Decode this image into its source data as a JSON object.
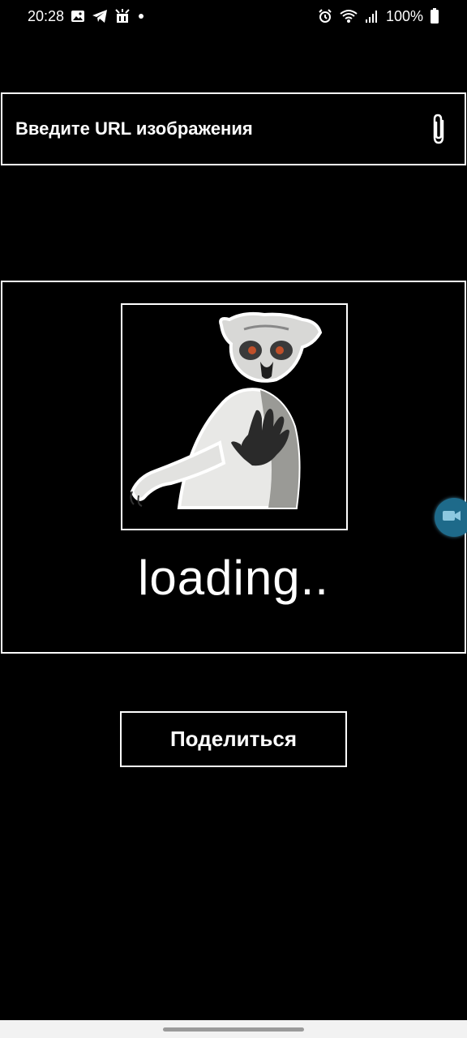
{
  "status_bar": {
    "time": "20:28",
    "battery": "100%",
    "left_icons": [
      "gallery-icon",
      "telegram-icon",
      "notification-icon",
      "dot-icon"
    ],
    "right_icons": [
      "alarm-icon",
      "wifi-icon",
      "signal-icon",
      "battery-icon"
    ]
  },
  "url_input": {
    "placeholder": "Введите URL изображения",
    "attach_icon": "paperclip-icon"
  },
  "preview": {
    "image_subject": "lemur",
    "status_text": "loading.."
  },
  "share_button": {
    "label": "Поделиться"
  },
  "floating_button": {
    "icon": "video-camera-icon",
    "color": "#1e6a8a"
  },
  "colors": {
    "background": "#000000",
    "foreground": "#ffffff",
    "nav_bar": "#f2f2f2"
  }
}
